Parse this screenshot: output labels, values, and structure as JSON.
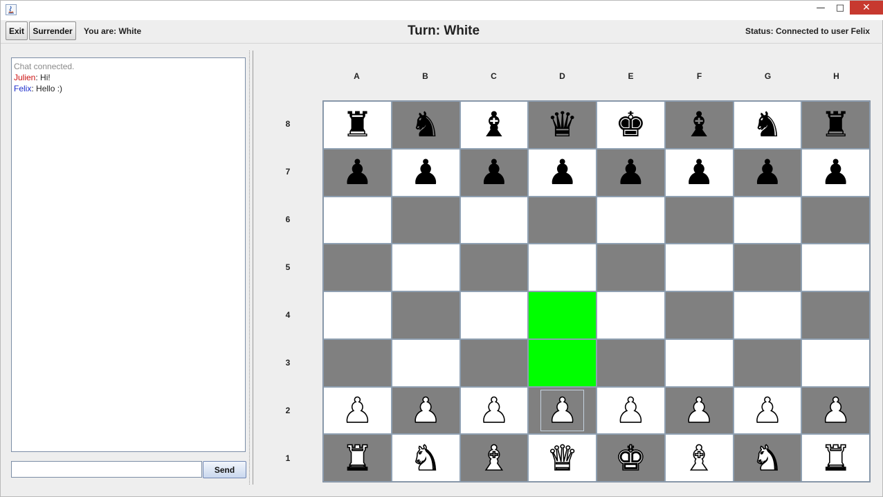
{
  "window": {
    "minimize_glyph": "—",
    "maximize_glyph": "□",
    "close_glyph": "✕"
  },
  "toolbar": {
    "exit_label": "Exit",
    "surrender_label": "Surrender",
    "you_are": "You are: White",
    "turn": "Turn: White",
    "status": "Status: Connected to user Felix"
  },
  "chat": {
    "system_message": "Chat connected.",
    "messages": [
      {
        "sender": "Julien",
        "text": " Hi!"
      },
      {
        "sender": "Felix",
        "text": " Hello :)"
      }
    ],
    "input_value": "",
    "send_label": "Send"
  },
  "board": {
    "files": [
      "A",
      "B",
      "C",
      "D",
      "E",
      "F",
      "G",
      "H"
    ],
    "ranks": [
      "8",
      "7",
      "6",
      "5",
      "4",
      "3",
      "2",
      "1"
    ],
    "position": [
      [
        "br",
        "bn",
        "bb",
        "bq",
        "bk",
        "bb",
        "bn",
        "br"
      ],
      [
        "bp",
        "bp",
        "bp",
        "bp",
        "bp",
        "bp",
        "bp",
        "bp"
      ],
      [
        "",
        "",
        "",
        "",
        "",
        "",
        "",
        ""
      ],
      [
        "",
        "",
        "",
        "",
        "",
        "",
        "",
        ""
      ],
      [
        "",
        "",
        "",
        "",
        "",
        "",
        "",
        ""
      ],
      [
        "",
        "",
        "",
        "",
        "",
        "",
        "",
        ""
      ],
      [
        "wp",
        "wp",
        "wp",
        "wp",
        "wp",
        "wp",
        "wp",
        "wp"
      ],
      [
        "wr",
        "wn",
        "wb",
        "wq",
        "wk",
        "wb",
        "wn",
        "wr"
      ]
    ],
    "selected_square": "D2",
    "highlighted_squares": [
      "D4",
      "D3"
    ],
    "colors": {
      "light": "#ffffff",
      "dark": "#808080",
      "highlight": "#00ff00"
    }
  }
}
